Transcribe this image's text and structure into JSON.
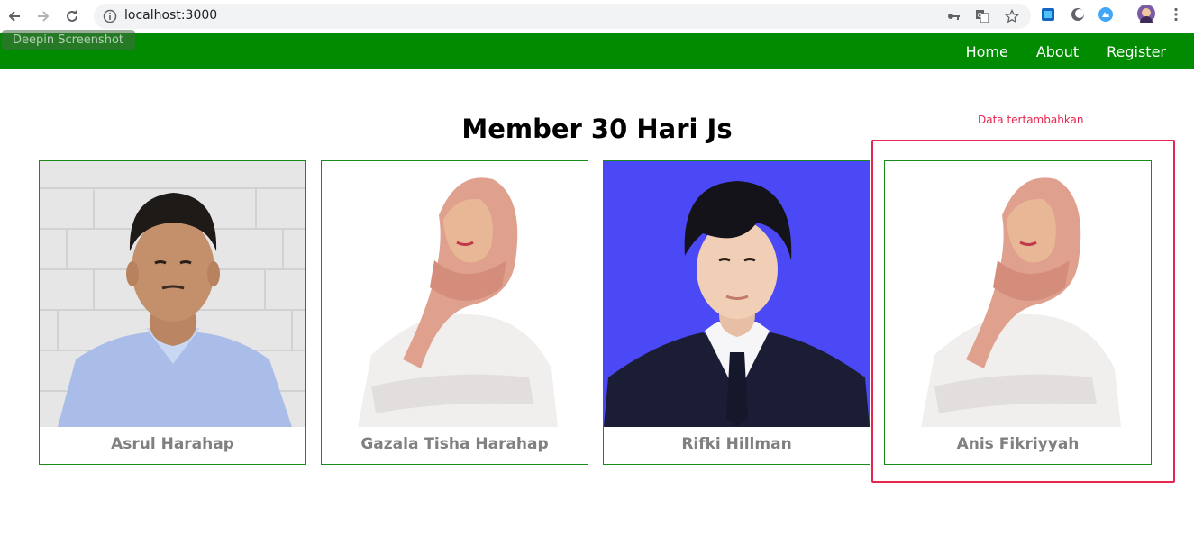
{
  "browser": {
    "url": "localhost:3000"
  },
  "overlay": {
    "deepin_label": "Deepin Screenshot"
  },
  "navbar": {
    "items": [
      {
        "label": "Home"
      },
      {
        "label": "About"
      },
      {
        "label": "Register"
      }
    ],
    "color": "#008b00"
  },
  "page": {
    "title": "Member 30 Hari Js",
    "notice": "Data tertambahkan",
    "notice_color": "#e8254c"
  },
  "members": [
    {
      "name": "Asrul Harahap",
      "photo": "man-blue-shirt-photo"
    },
    {
      "name": "Gazala Tisha Harahap",
      "photo": "woman-hijab-photo"
    },
    {
      "name": "Rifki Hillman",
      "photo": "man-suit-photo"
    },
    {
      "name": "Anis Fikriyyah",
      "photo": "woman-hijab-photo"
    }
  ]
}
